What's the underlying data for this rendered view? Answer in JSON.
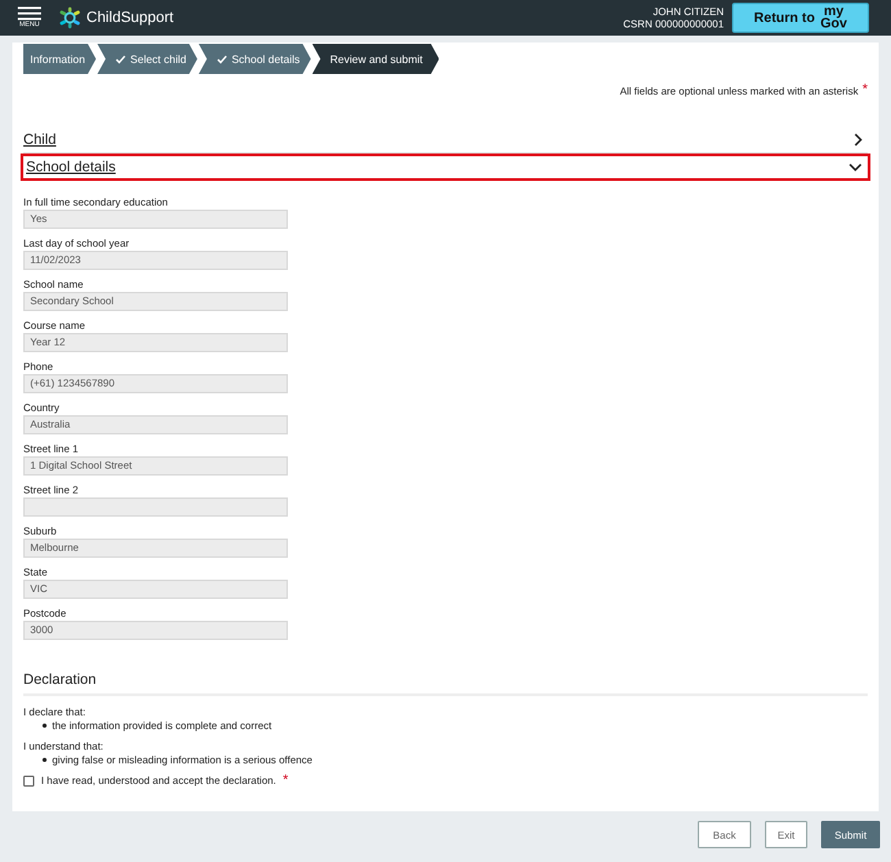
{
  "header": {
    "menu_label": "MENU",
    "app_name": "ChildSupport",
    "user_name": "JOHN CITIZEN",
    "csrn": "CSRN 000000000001",
    "return_button": {
      "label": "Return to",
      "brand_top": "my",
      "brand_bottom": "Gov"
    }
  },
  "steps": [
    {
      "label": "Information",
      "checked": false,
      "selected": false
    },
    {
      "label": "Select child",
      "checked": true,
      "selected": false
    },
    {
      "label": "School details",
      "checked": true,
      "selected": false
    },
    {
      "label": "Review and submit",
      "checked": false,
      "selected": true
    }
  ],
  "required_note": {
    "text": "All fields are optional unless marked with an asterisk",
    "asterisk": "*"
  },
  "sections": [
    {
      "title": "Child",
      "expanded": false,
      "focused": false
    },
    {
      "title": "School details",
      "expanded": true,
      "focused": true
    }
  ],
  "fields": [
    {
      "label": "In full time secondary education",
      "value": "Yes"
    },
    {
      "label": "Last day of school year",
      "value": "11/02/2023"
    },
    {
      "label": "School name",
      "value": "Secondary School"
    },
    {
      "label": "Course name",
      "value": "Year 12"
    },
    {
      "label": "Phone",
      "value": "(+61)  1234567890"
    },
    {
      "label": "Country",
      "value": "Australia"
    },
    {
      "label": "Street line 1",
      "value": "1 Digital School Street"
    },
    {
      "label": "Street line 2"
    },
    {
      "label": "Suburb",
      "value": "Melbourne"
    },
    {
      "label": "State",
      "value": "VIC"
    },
    {
      "label": "Postcode",
      "value": "3000"
    }
  ],
  "declaration": {
    "title": "Declaration",
    "groups": [
      {
        "intro": "I declare that:",
        "items": [
          "the information provided is complete and correct"
        ]
      },
      {
        "intro": "I understand that:",
        "items": [
          "giving false or misleading information is a serious offence"
        ]
      }
    ],
    "accept": {
      "label": "I have read, understood and accept the declaration.",
      "asterisk": "*",
      "checked": false
    }
  },
  "buttons": [
    {
      "label": "Back",
      "kind": "secondary"
    },
    {
      "label": "Exit",
      "kind": "secondary"
    },
    {
      "label": "Submit",
      "kind": "primary"
    }
  ]
}
